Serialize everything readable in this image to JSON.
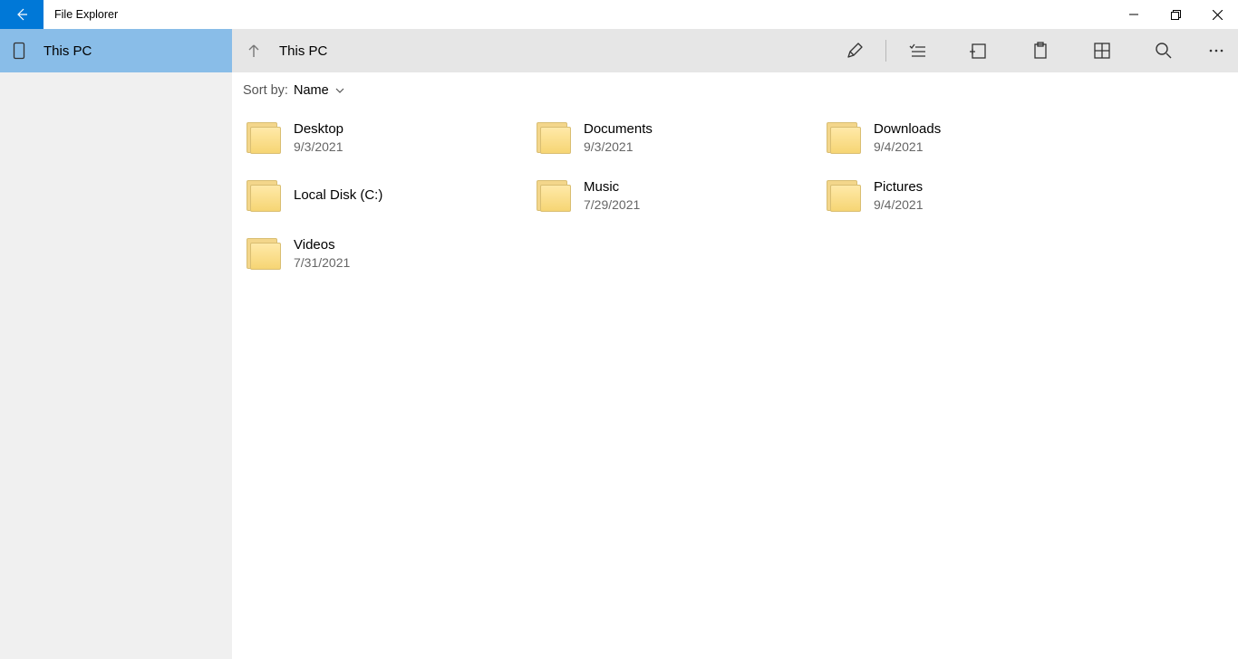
{
  "window": {
    "title": "File Explorer"
  },
  "sidebar": {
    "items": [
      {
        "label": "This PC",
        "active": true
      }
    ]
  },
  "toolbar": {
    "location": "This PC"
  },
  "sort": {
    "label": "Sort by:",
    "value": "Name"
  },
  "items": [
    {
      "name": "Desktop",
      "date": "9/3/2021"
    },
    {
      "name": "Documents",
      "date": "9/3/2021"
    },
    {
      "name": "Downloads",
      "date": "9/4/2021"
    },
    {
      "name": "Local Disk (C:)",
      "date": ""
    },
    {
      "name": "Music",
      "date": "7/29/2021"
    },
    {
      "name": "Pictures",
      "date": "9/4/2021"
    },
    {
      "name": "Videos",
      "date": "7/31/2021"
    }
  ]
}
